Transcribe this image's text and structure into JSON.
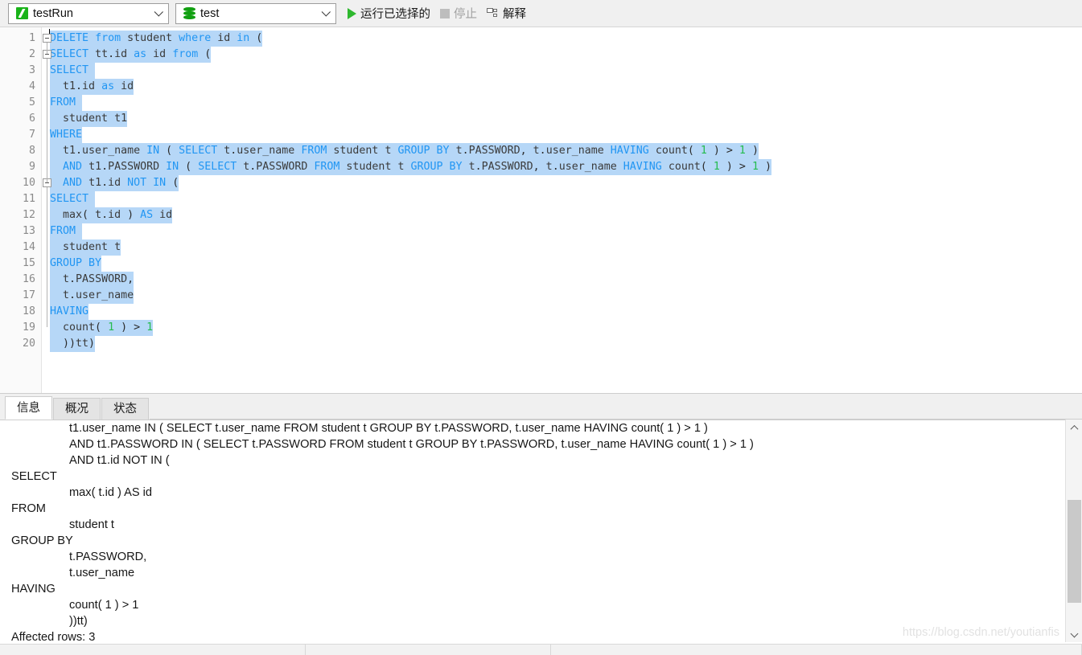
{
  "toolbar": {
    "script_combo": {
      "label": "testRun",
      "icon": "sql-file-icon"
    },
    "db_combo": {
      "label": "test",
      "icon": "database-icon"
    },
    "run_selected": {
      "label": "运行已选择的",
      "icon": "play-icon",
      "enabled": true
    },
    "stop": {
      "label": "停止",
      "icon": "stop-icon",
      "enabled": false
    },
    "explain": {
      "label": "解释",
      "icon": "explain-icon",
      "enabled": true
    }
  },
  "editor": {
    "selection_color": "#b6d7f7",
    "keyword_color": "#2196f3",
    "number_color": "#25bb4f",
    "lines": [
      {
        "n": "1",
        "text": "DELETE from student where id in ("
      },
      {
        "n": "2",
        "text": "SELECT tt.id as id from ("
      },
      {
        "n": "3",
        "text": "SELECT "
      },
      {
        "n": "4",
        "text": "  t1.id as id"
      },
      {
        "n": "5",
        "text": "FROM "
      },
      {
        "n": "6",
        "text": "  student t1"
      },
      {
        "n": "7",
        "text": "WHERE"
      },
      {
        "n": "8",
        "text": "  t1.user_name IN ( SELECT t.user_name FROM student t GROUP BY t.PASSWORD, t.user_name HAVING count( 1 ) > 1 )"
      },
      {
        "n": "9",
        "text": "  AND t1.PASSWORD IN ( SELECT t.PASSWORD FROM student t GROUP BY t.PASSWORD, t.user_name HAVING count( 1 ) > 1 )"
      },
      {
        "n": "10",
        "text": "  AND t1.id NOT IN ("
      },
      {
        "n": "11",
        "text": "SELECT "
      },
      {
        "n": "12",
        "text": "  max( t.id ) AS id"
      },
      {
        "n": "13",
        "text": "FROM "
      },
      {
        "n": "14",
        "text": "  student t"
      },
      {
        "n": "15",
        "text": "GROUP BY"
      },
      {
        "n": "16",
        "text": "  t.PASSWORD,"
      },
      {
        "n": "17",
        "text": "  t.user_name"
      },
      {
        "n": "18",
        "text": "HAVING"
      },
      {
        "n": "19",
        "text": "  count( 1 ) > 1"
      },
      {
        "n": "20",
        "text": "  ))tt)"
      }
    ]
  },
  "bottom_panel": {
    "tabs": [
      {
        "label": "信息",
        "active": true
      },
      {
        "label": "概况",
        "active": false
      },
      {
        "label": "状态",
        "active": false
      }
    ],
    "messages": [
      {
        "text": "t1.user_name IN ( SELECT t.user_name FROM student t GROUP BY t.PASSWORD, t.user_name HAVING count( 1 ) > 1 )",
        "indent": true
      },
      {
        "text": "AND t1.PASSWORD IN ( SELECT t.PASSWORD FROM student t GROUP BY t.PASSWORD, t.user_name HAVING count( 1 ) > 1 )",
        "indent": true
      },
      {
        "text": "AND t1.id NOT IN (",
        "indent": true
      },
      {
        "text": "SELECT",
        "indent": false
      },
      {
        "text": "max( t.id ) AS id",
        "indent": true
      },
      {
        "text": "FROM",
        "indent": false
      },
      {
        "text": "student t",
        "indent": true
      },
      {
        "text": "GROUP BY",
        "indent": false
      },
      {
        "text": "t.PASSWORD,",
        "indent": true
      },
      {
        "text": "t.user_name",
        "indent": true
      },
      {
        "text": "HAVING",
        "indent": false
      },
      {
        "text": "count( 1 ) > 1",
        "indent": true
      },
      {
        "text": "))tt)",
        "indent": true
      },
      {
        "text": "Affected rows: 3",
        "indent": false
      }
    ]
  },
  "watermark": {
    "text": "https://blog.csdn.net/youtianfis"
  }
}
